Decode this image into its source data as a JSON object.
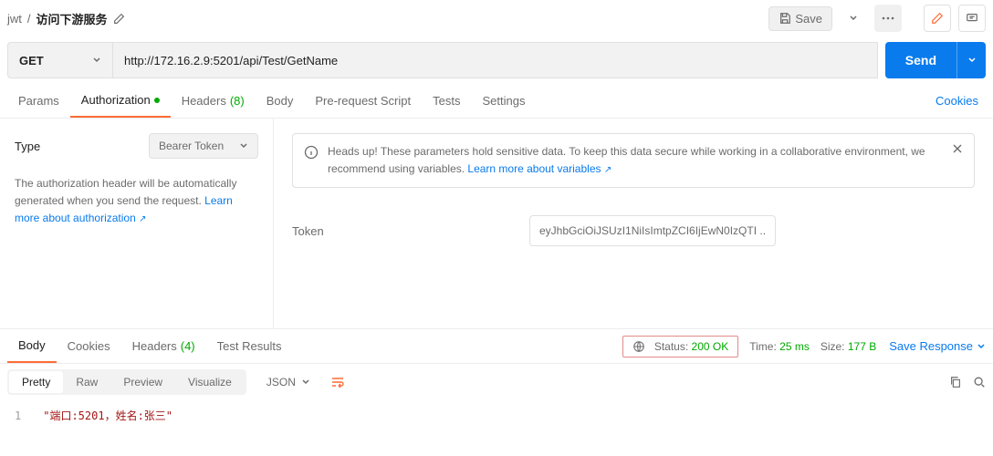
{
  "breadcrumb": {
    "parent": "jwt",
    "sep": "/",
    "current": "访问下游服务"
  },
  "topbar": {
    "save": "Save"
  },
  "request": {
    "method": "GET",
    "url": "http://172.16.2.9:5201/api/Test/GetName",
    "send": "Send"
  },
  "tabs": {
    "params": "Params",
    "auth": "Authorization",
    "headers": "Headers",
    "headers_count": "(8)",
    "body": "Body",
    "prereq": "Pre-request Script",
    "tests": "Tests",
    "settings": "Settings",
    "cookies": "Cookies"
  },
  "auth": {
    "type_label": "Type",
    "type_value": "Bearer Token",
    "desc": "The authorization header will be automatically generated when you send the request. ",
    "desc_link": "Learn more about authorization",
    "alert": "Heads up! These parameters hold sensitive data. To keep this data secure while working in a collaborative environment, we recommend using variables. ",
    "alert_link": "Learn more about variables",
    "token_label": "Token",
    "token_value": "eyJhbGciOiJSUzI1NiIsImtpZCI6IjEwN0IzQTI ..."
  },
  "resp_tabs": {
    "body": "Body",
    "cookies": "Cookies",
    "headers": "Headers",
    "headers_count": "(4)",
    "test": "Test Results"
  },
  "status": {
    "label": "Status:",
    "value": "200 OK",
    "time_label": "Time:",
    "time_value": "25 ms",
    "size_label": "Size:",
    "size_value": "177 B",
    "save": "Save Response"
  },
  "view": {
    "pretty": "Pretty",
    "raw": "Raw",
    "preview": "Preview",
    "visualize": "Visualize",
    "format": "JSON"
  },
  "body": {
    "line": "1",
    "content": "\"端口:5201，姓名:张三\""
  }
}
